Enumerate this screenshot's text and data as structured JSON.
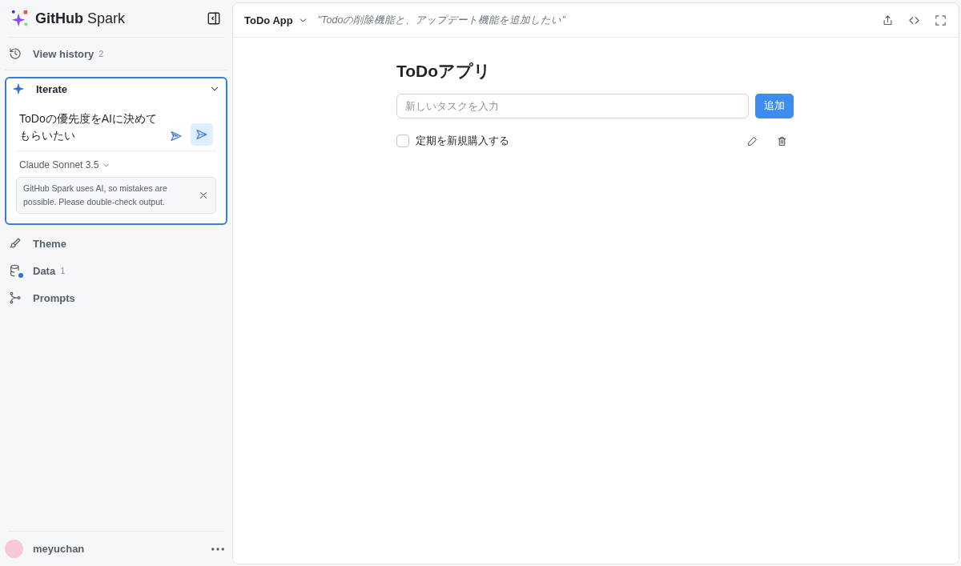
{
  "brand": {
    "name": "**GitHub** Spark"
  },
  "history": {
    "label": "View history",
    "count": "2"
  },
  "iterate": {
    "title": "Iterate",
    "expanded": true,
    "prompt": "ToDoの優先度をAIに決めてもらいたい",
    "model": "Claude Sonnet 3.5",
    "notice": "GitHub Spark uses AI, so mistakes are possible. Please double-check output."
  },
  "nav": [
    {
      "kind": "theme",
      "label": "Theme"
    },
    {
      "kind": "data",
      "label": "Data",
      "count": "1"
    },
    {
      "kind": "prompts",
      "label": "Prompts"
    }
  ],
  "user": {
    "name": "meyuchan"
  },
  "topbar": {
    "app_name": "ToDo App",
    "last_prompt": "\"Todoの削除機能と、アップデート機能を追加したい\""
  },
  "app": {
    "title": "ToDoアプリ",
    "input_placeholder": "新しいタスクを入力",
    "add_button": "追加",
    "todos": [
      {
        "text": "定期を新規購入する",
        "checked": false
      }
    ]
  }
}
